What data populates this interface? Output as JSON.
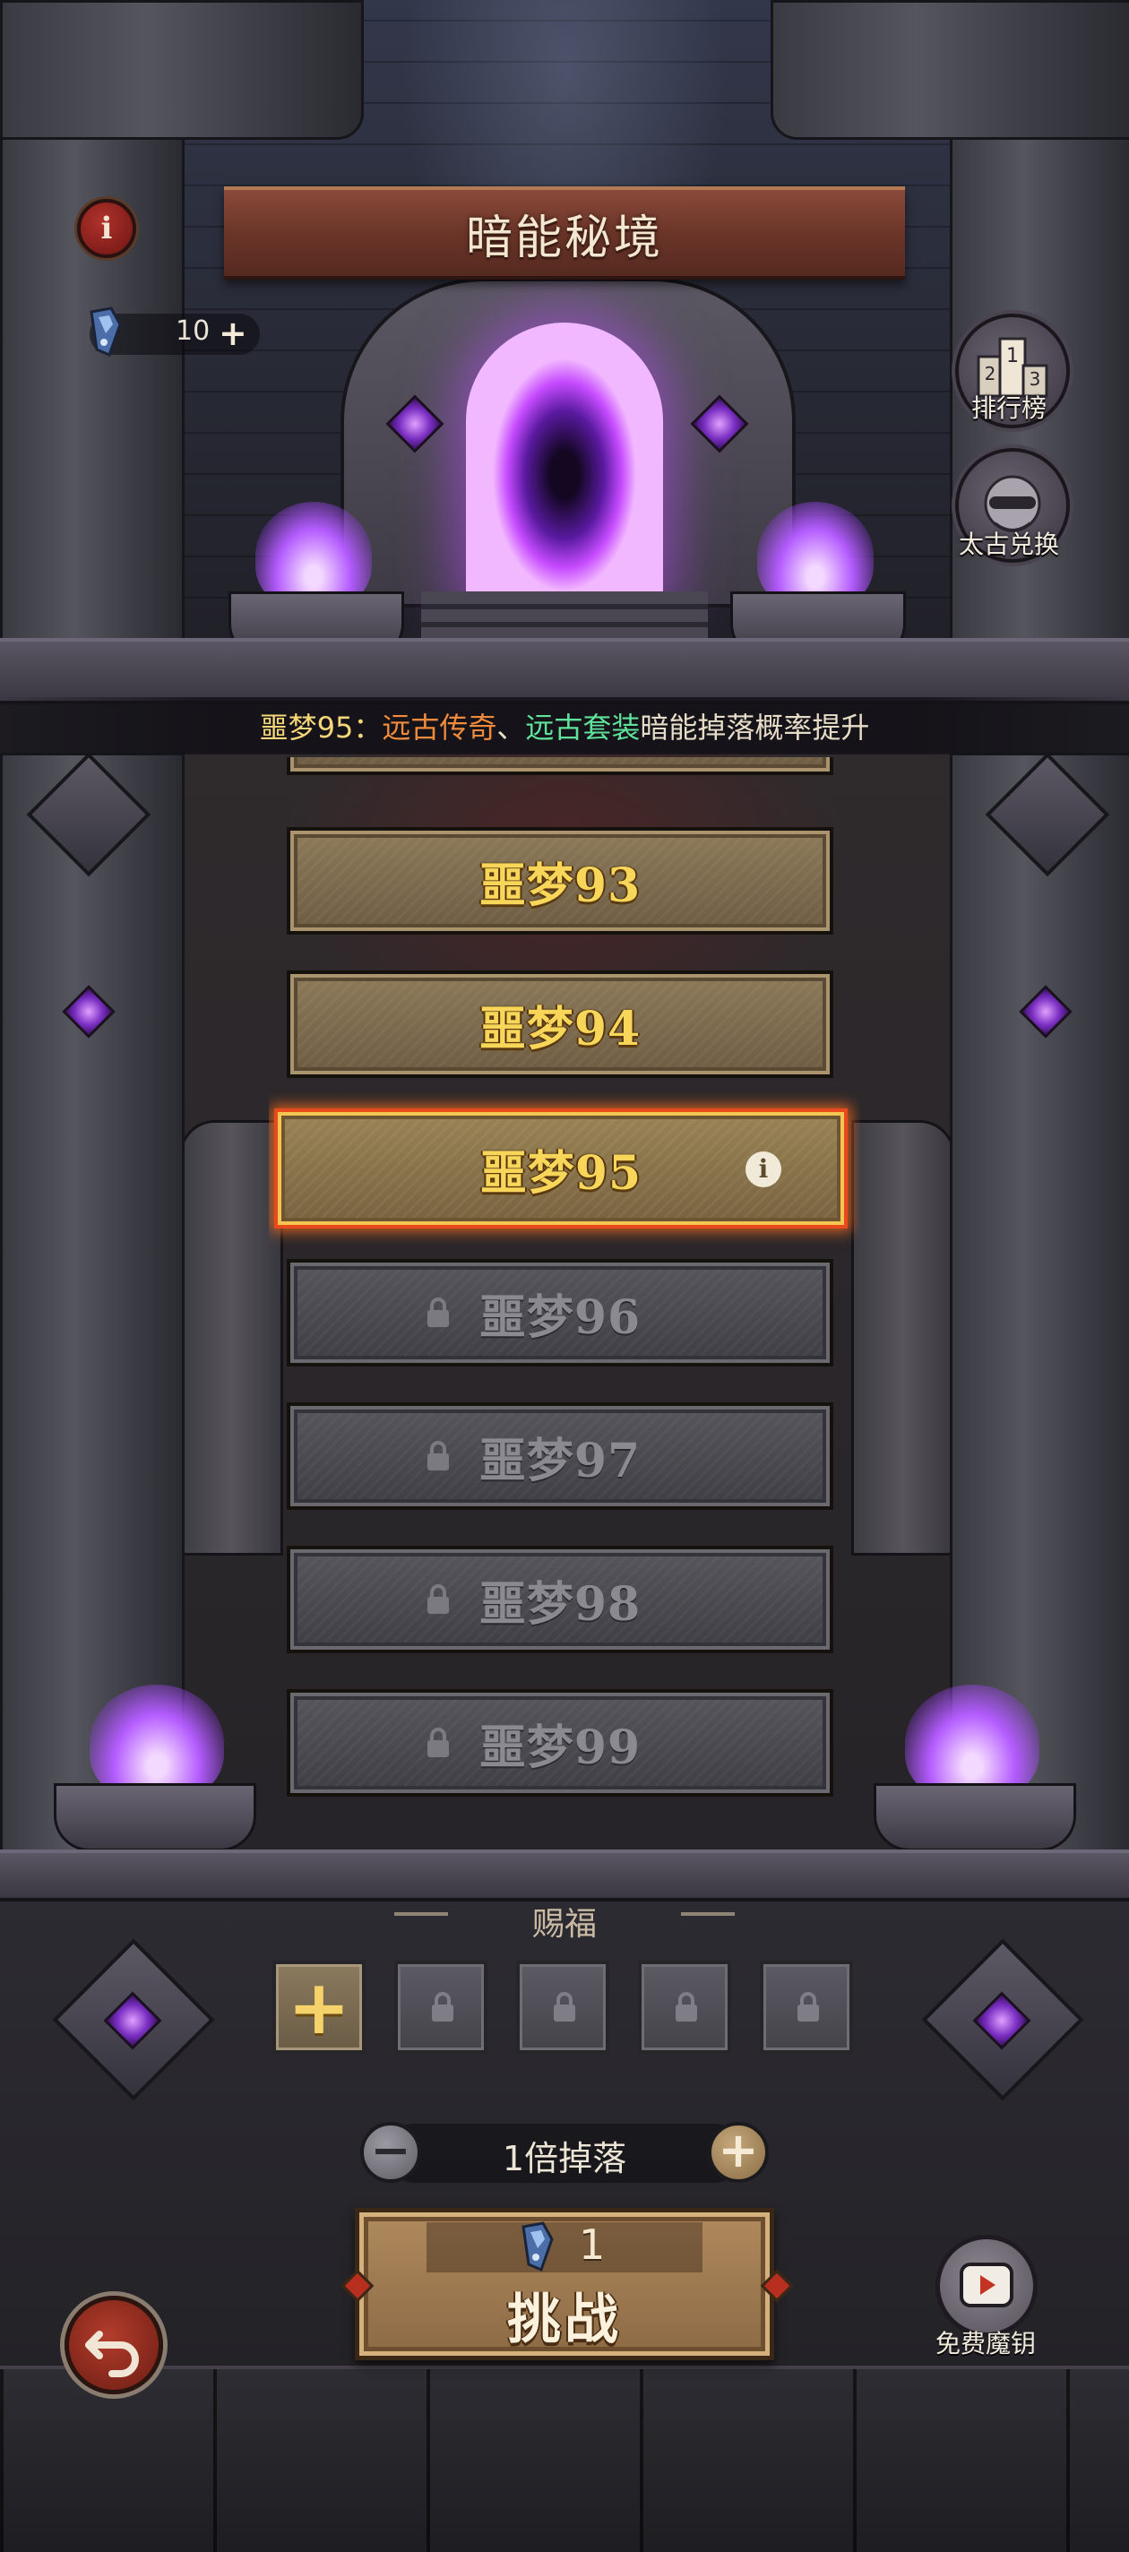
{
  "header": {
    "title": "暗能秘境",
    "key_count": "10"
  },
  "side_buttons": {
    "leaderboard": "排行榜",
    "exchange": "太古兑换"
  },
  "notice": {
    "prefix": "噩梦95：",
    "item_a": "远古传奇",
    "separator": "、",
    "item_b": "远古套装",
    "suffix": "暗能掉落概率提升"
  },
  "levels": [
    {
      "label": "噩梦93",
      "state": "unlocked"
    },
    {
      "label": "噩梦94",
      "state": "unlocked"
    },
    {
      "label": "噩梦95",
      "state": "selected"
    },
    {
      "label": "噩梦96",
      "state": "locked"
    },
    {
      "label": "噩梦97",
      "state": "locked"
    },
    {
      "label": "噩梦98",
      "state": "locked"
    },
    {
      "label": "噩梦99",
      "state": "locked"
    }
  ],
  "blessing": {
    "label": "赐福",
    "slots": [
      "add",
      "locked",
      "locked",
      "locked",
      "locked"
    ]
  },
  "multiplier": {
    "label": "1倍掉落"
  },
  "challenge": {
    "cost": "1",
    "label": "挑战"
  },
  "free_key": {
    "label": "免费魔钥"
  },
  "colors": {
    "notice_prefix": "#f5d77a",
    "notice_item_a": "#f08a3c",
    "notice_item_b": "#5fe39a",
    "selected_border": "#e84a1c",
    "level_text": "#f8d65a"
  },
  "icons": [
    "info-icon",
    "key-icon",
    "plus-icon",
    "leaderboard-icon",
    "exchange-icon",
    "lock-icon",
    "minus-icon",
    "back-arrow-icon",
    "video-play-icon"
  ]
}
